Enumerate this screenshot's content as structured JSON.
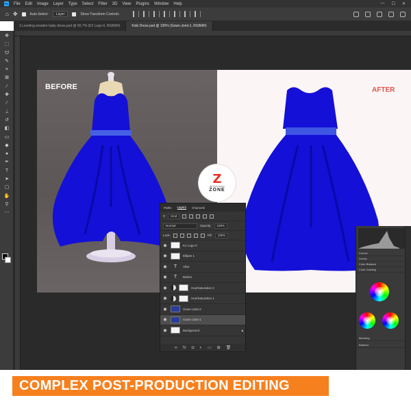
{
  "menu": {
    "logo": "Ps",
    "items": [
      "File",
      "Edit",
      "Image",
      "Layer",
      "Type",
      "Select",
      "Filter",
      "3D",
      "View",
      "Plugins",
      "Window",
      "Help"
    ],
    "window_controls": [
      "—",
      "☐",
      "✕"
    ]
  },
  "options_bar": {
    "auto_select_label": "Auto-Select:",
    "auto_select_value": "Layer",
    "show_transform_label": "Show Transform Controls"
  },
  "tabs": [
    {
      "label": "1.Leveling wooden baby dress.psd @ 66.7% (K2 Logo-0, RGB/8#)",
      "active": false
    },
    {
      "label": "Kids Dress.psd @ 100% (Gown-Joint-1, RGB/8#)",
      "active": true
    }
  ],
  "canvas": {
    "before_label": "BEFORE",
    "after_label": "AFTER",
    "before_bg": "#625b5b",
    "after_bg": "#fbf5f5",
    "dress_color": "#1410d8",
    "after_label_color": "#e2534a"
  },
  "logo": {
    "mark": "Z",
    "tagline": "RETOUCHING",
    "name": "ZONE"
  },
  "layers_panel": {
    "tabs": [
      "Paths",
      "Layers",
      "Channels"
    ],
    "active_tab": "Layers",
    "kind_label": "Kind",
    "blend_mode": "Normal",
    "opacity_label": "Opacity:",
    "opacity_value": "100%",
    "lock_label": "Lock:",
    "fill_label": "Fill:",
    "fill_value": "100%",
    "layers": [
      {
        "name": "K2 Logo-0",
        "kind": "image",
        "selected": false
      },
      {
        "name": "Ellipse 1",
        "kind": "image",
        "selected": false
      },
      {
        "name": "After",
        "kind": "text",
        "selected": false
      },
      {
        "name": "Before",
        "kind": "text",
        "selected": false
      },
      {
        "name": "Hue/Saturation 2",
        "kind": "adjustment",
        "selected": false
      },
      {
        "name": "Hue/Saturation 1",
        "kind": "adjustment",
        "selected": false
      },
      {
        "name": "Gown-Joint-2",
        "kind": "photo",
        "selected": false
      },
      {
        "name": "Gown-Joint-1",
        "kind": "photo",
        "selected": true
      },
      {
        "name": "Background",
        "kind": "image",
        "selected": false
      }
    ],
    "footer_icons": [
      "link-icon",
      "fx-icon",
      "mask-icon",
      "adjustment-icon",
      "folder-icon",
      "new-layer-icon",
      "trash-icon"
    ]
  },
  "properties_panel": {
    "sections": [
      "Curves",
      "Levels",
      "Color Balance",
      "Color Grading"
    ],
    "bottom_sections": [
      "Blending",
      "Balance"
    ]
  },
  "banner": {
    "text": "COMPLEX POST-PRODUCTION EDITING",
    "color": "#f7801e"
  }
}
